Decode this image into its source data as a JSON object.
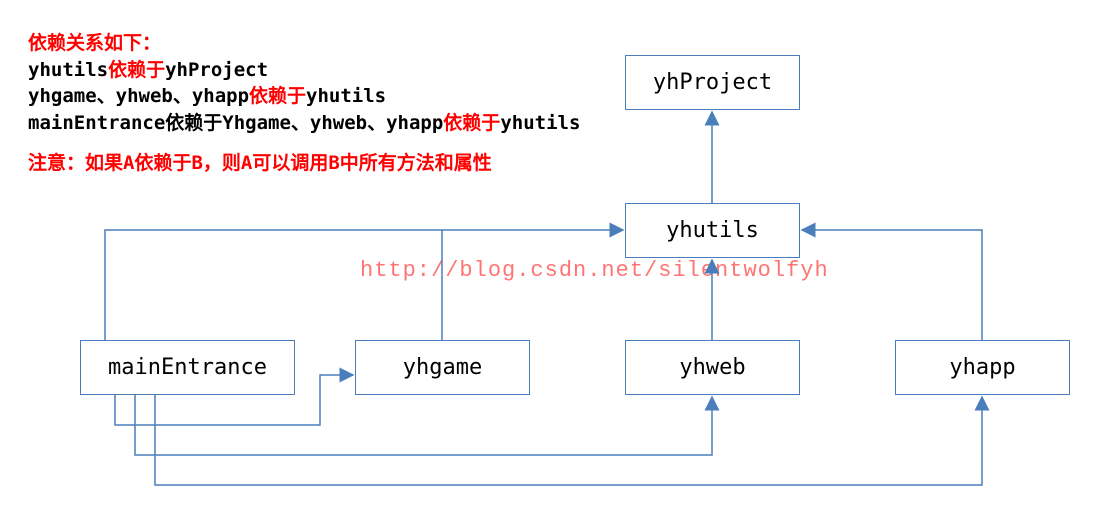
{
  "title": {
    "heading": "依赖关系如下：",
    "lines": [
      {
        "parts": [
          {
            "text": "yhutils",
            "cls": "black"
          },
          {
            "text": "依赖于",
            "cls": "red"
          },
          {
            "text": "yhProject",
            "cls": "black"
          }
        ]
      },
      {
        "parts": [
          {
            "text": "yhgame、yhweb、yhapp",
            "cls": "black"
          },
          {
            "text": "依赖于",
            "cls": "red"
          },
          {
            "text": "yhutils",
            "cls": "black"
          }
        ]
      },
      {
        "parts": [
          {
            "text": "mainEntrance依赖于Yhgame、yhweb、yhapp",
            "cls": "black"
          },
          {
            "text": "依赖于",
            "cls": "red"
          },
          {
            "text": "yhutils",
            "cls": "black"
          }
        ]
      }
    ],
    "note": "注意：如果A依赖于B，则A可以调用B中所有方法和属性"
  },
  "watermark": "http://blog.csdn.net/silentwolfyh",
  "nodes": {
    "yhProject": "yhProject",
    "yhutils": "yhutils",
    "mainEntrance": "mainEntrance",
    "yhgame": "yhgame",
    "yhweb": "yhweb",
    "yhapp": "yhapp"
  },
  "chart_data": {
    "type": "dependency-diagram",
    "nodes": [
      "yhProject",
      "yhutils",
      "mainEntrance",
      "yhgame",
      "yhweb",
      "yhapp"
    ],
    "edges_depends_on": [
      {
        "from": "yhutils",
        "to": "yhProject"
      },
      {
        "from": "yhgame",
        "to": "yhutils"
      },
      {
        "from": "yhweb",
        "to": "yhutils"
      },
      {
        "from": "yhapp",
        "to": "yhutils"
      },
      {
        "from": "mainEntrance",
        "to": "yhutils"
      },
      {
        "from": "mainEntrance",
        "to": "yhgame"
      },
      {
        "from": "mainEntrance",
        "to": "yhweb"
      },
      {
        "from": "mainEntrance",
        "to": "yhapp"
      }
    ]
  }
}
